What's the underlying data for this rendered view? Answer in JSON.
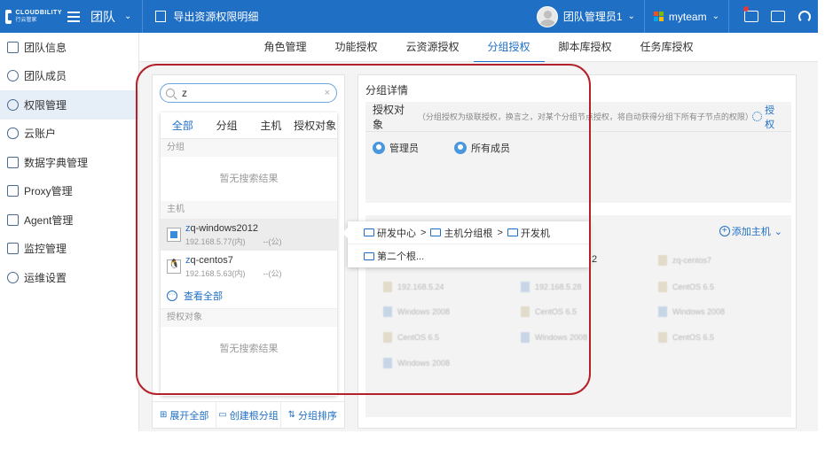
{
  "topbar": {
    "logo_line1": "CLOUDBILITY",
    "logo_line2": "行云管家",
    "team_title": "团队",
    "export_label": "导出资源权限明细",
    "user_name": "团队管理员1",
    "team_name": "myteam",
    "ms_colors": [
      "#f25022",
      "#7fba00",
      "#00a4ef",
      "#ffb900"
    ]
  },
  "sidebar": {
    "items": [
      {
        "label": "团队信息",
        "icon": "team-info-icon"
      },
      {
        "label": "团队成员",
        "icon": "team-members-icon"
      },
      {
        "label": "权限管理",
        "icon": "permission-icon",
        "active": true
      },
      {
        "label": "云账户",
        "icon": "cloud-icon"
      },
      {
        "label": "数据字典管理",
        "icon": "dictionary-icon"
      },
      {
        "label": "Proxy管理",
        "icon": "proxy-icon"
      },
      {
        "label": "Agent管理",
        "icon": "agent-icon"
      },
      {
        "label": "监控管理",
        "icon": "monitor-icon"
      },
      {
        "label": "运维设置",
        "icon": "ops-settings-icon"
      }
    ]
  },
  "subtabs": [
    "角色管理",
    "功能授权",
    "云资源授权",
    "分组授权",
    "脚本库授权",
    "任务库授权"
  ],
  "subtab_active": "分组授权",
  "search": {
    "value": "z",
    "clear": "×"
  },
  "dropdown": {
    "tabs": [
      "全部",
      "分组",
      "主机",
      "授权对象"
    ],
    "active_tab": "全部",
    "section_group": "分组",
    "section_host": "主机",
    "section_auth": "授权对象",
    "empty_text": "暂无搜索结果",
    "hosts": [
      {
        "name_highlight": "z",
        "name_rest": "q-windows2012",
        "ip": "192.168.5.77(内)",
        "pub": "--(公)",
        "os": "windows"
      },
      {
        "name_highlight": "z",
        "name_rest": "q-centos7",
        "ip": "192.168.5.63(内)",
        "pub": "--(公)",
        "os": "linux"
      }
    ],
    "view_all": "查看全部"
  },
  "left_footer": {
    "expand": "展开全部",
    "create_root": "创建根分组",
    "sort": "分组排序"
  },
  "detail": {
    "title": "分组详情",
    "auth_label": "授权对象",
    "auth_hint": "（分组授权为级联授权，换言之，对某个分组节点授权，将自动获得分组下所有子节点的权限）",
    "auth_button": "授权",
    "objects": [
      "管理员",
      "所有成员"
    ],
    "add_host": "添加主机",
    "stray_text": "2",
    "blurred_hosts": [
      "zq-centos7",
      "192.168.5.24",
      "192.168.5.28",
      "CentOS 6.5",
      "Windows 2008",
      "CentOS 6.5",
      "Windows 2008",
      "CentOS 6.5",
      "Windows 2008",
      "CentOS 6.5",
      "Windows 2008"
    ]
  },
  "path_popup": {
    "row1": [
      "研发中心",
      "主机分组根",
      "开发机"
    ],
    "row1_sep": ">",
    "row2": "第二个根..."
  }
}
